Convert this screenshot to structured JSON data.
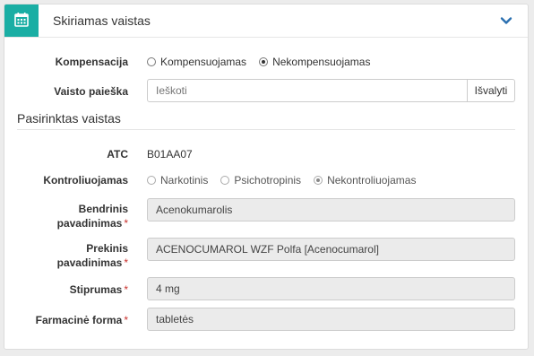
{
  "header": {
    "title": "Skiriamas vaistas",
    "icon": "calendar-icon",
    "accent": "#1aaea4"
  },
  "compensation": {
    "label": "Kompensacija",
    "options": [
      {
        "label": "Kompensuojamas",
        "selected": false
      },
      {
        "label": "Nekompensuojamas",
        "selected": true
      }
    ]
  },
  "search": {
    "label": "Vaisto paieška",
    "placeholder": "Ieškoti",
    "clear_label": "Išvalyti"
  },
  "selected_section": {
    "title": "Pasirinktas vaistas"
  },
  "atc": {
    "label": "ATC",
    "value": "B01AA07"
  },
  "controlled": {
    "label": "Kontroliuojamas",
    "options": [
      {
        "label": "Narkotinis",
        "selected": false
      },
      {
        "label": "Psichotropinis",
        "selected": false
      },
      {
        "label": "Nekontroliuojamas",
        "selected": true
      }
    ]
  },
  "generic_name": {
    "label_line1": "Bendrinis",
    "label_line2": "pavadinimas",
    "required": "*",
    "value": "Acenokumarolis"
  },
  "trade_name": {
    "label_line1": "Prekinis",
    "label_line2": "pavadinimas",
    "required": "*",
    "value": "ACENOCUMAROL WZF Polfa [Acenocumarol]"
  },
  "strength": {
    "label": "Stiprumas",
    "required": "*",
    "value": "4 mg"
  },
  "form": {
    "label": "Farmacinė forma",
    "required": "*",
    "value": "tabletės"
  }
}
